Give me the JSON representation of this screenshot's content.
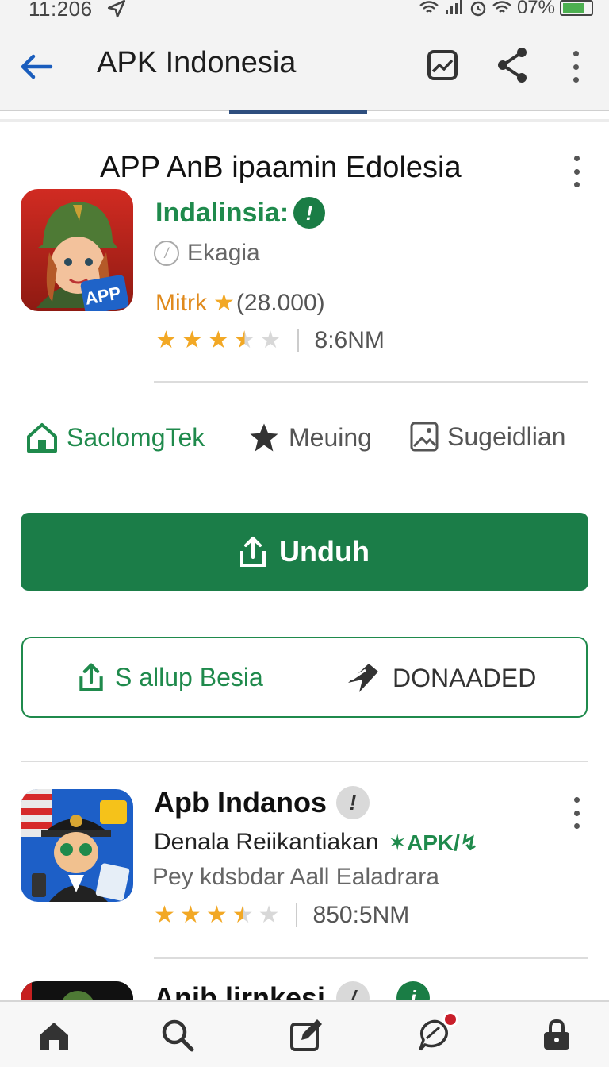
{
  "status_bar": {
    "time": "11:206",
    "battery": "07%"
  },
  "app_bar": {
    "title": "APK Indonesia"
  },
  "featured": {
    "title": "APP AnB ipaamin Edolesia",
    "icon_label": "APP",
    "developer": "Indalinsia:",
    "verified_glyph": "!",
    "category": "Ekagia",
    "category_glyph": "/",
    "rating_label": "Mitrk",
    "rating_star": "★",
    "rating_count": "(28.000)",
    "stars": 3.5,
    "size": "8:6NM"
  },
  "chips": [
    {
      "label": "SaclomgTek",
      "icon": "home-icon"
    },
    {
      "label": "Meuing",
      "icon": "star-icon"
    },
    {
      "label": "Sugeidlian",
      "icon": "image-icon"
    }
  ],
  "download": {
    "label": "Unduh"
  },
  "secondary": {
    "share_label": "S allup Besia",
    "download_label": "DONAADED"
  },
  "apps": [
    {
      "name": "Apb Indanos",
      "badge": "!",
      "developer": "Denala Reiikantiakan",
      "tag": "✶APK/↯",
      "subtitle": "Pey kdsbdar Aall Ealadrara",
      "stars": 3.5,
      "size": "850:5NM"
    },
    {
      "name": "Anib lirnkesi",
      "badge": "/",
      "badge2": "i"
    }
  ],
  "bottom_nav": [
    "home-icon",
    "search-icon",
    "edit-icon",
    "chat-icon",
    "lock-icon"
  ],
  "colors": {
    "accent": "#1b7d48",
    "brand_blue": "#1a5dbd",
    "star": "#f2a825"
  }
}
